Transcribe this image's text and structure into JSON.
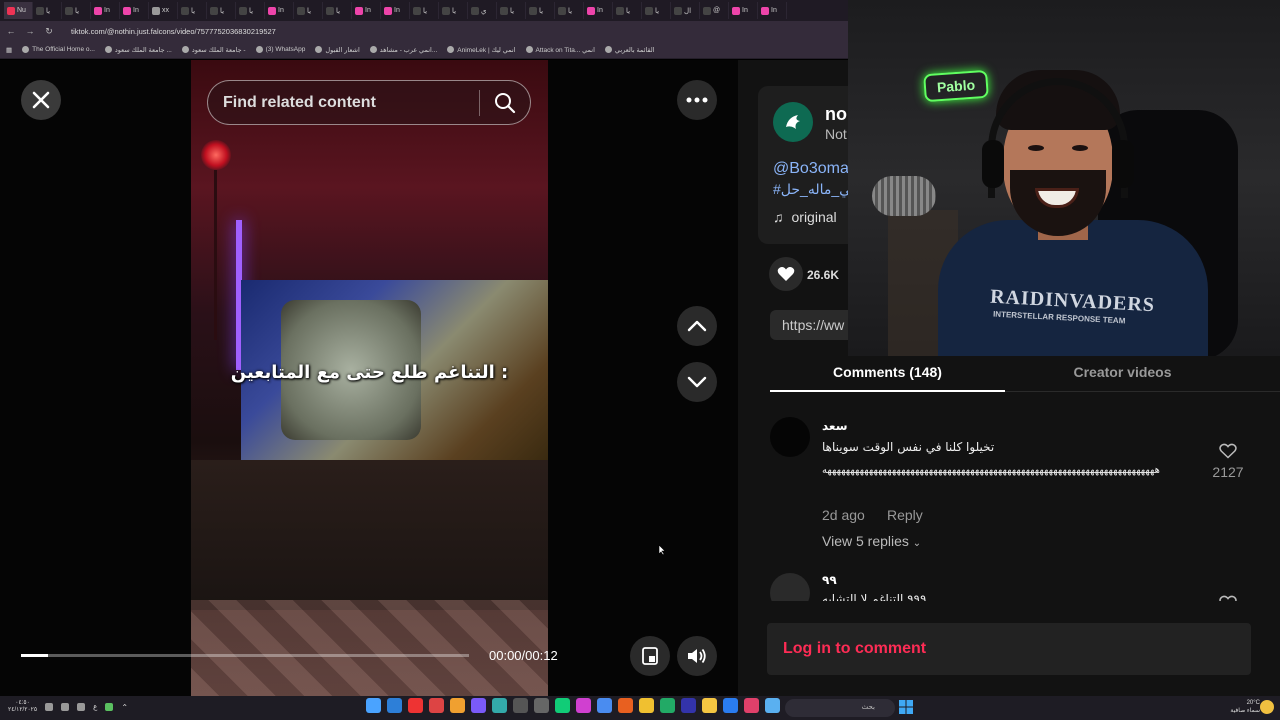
{
  "browser": {
    "tabs": [
      {
        "label": "Nu"
      },
      {
        "label": "يا"
      },
      {
        "label": "يا"
      },
      {
        "label": "In"
      },
      {
        "label": "In"
      },
      {
        "label": "xx"
      },
      {
        "label": "يا"
      },
      {
        "label": "يا"
      },
      {
        "label": "يا"
      },
      {
        "label": "In"
      },
      {
        "label": "يا"
      },
      {
        "label": "يا"
      },
      {
        "label": "In"
      },
      {
        "label": "In"
      },
      {
        "label": "يا"
      },
      {
        "label": "يا"
      },
      {
        "label": "ي"
      },
      {
        "label": "يا"
      },
      {
        "label": "يا"
      },
      {
        "label": "يا"
      },
      {
        "label": "In"
      },
      {
        "label": "يا"
      },
      {
        "label": "يا"
      },
      {
        "label": "ال"
      },
      {
        "label": "@"
      },
      {
        "label": "In"
      },
      {
        "label": "In"
      }
    ],
    "url": "tiktok.com/@nothin.just.falcons/video/7577752036830219527",
    "bookmarks": [
      "The Official Home o...",
      "جامعة الملك سعود ...",
      "جامعة الملك سعود -",
      "(3) WhatsApp",
      "اشعار القبول",
      "انمي عرب - مشاهد...",
      "AnimeLek | انمي ليك",
      "Attack on Tita... انمي",
      "القائمة بالعربي"
    ]
  },
  "video": {
    "search_placeholder": "Find related content",
    "caption": "التناغم طلع حتى مع المتابعين :",
    "time": "00:00/00:12",
    "progress": 0.06
  },
  "author": {
    "name": "no",
    "subtitle": "Not",
    "mention": "@Bo3oma",
    "hashtag": "#اللي_ماله_حل",
    "sound": "original",
    "likes": "26.6K",
    "link": "https://ww"
  },
  "tabs": {
    "comments": "Comments (148)",
    "creator": "Creator videos"
  },
  "comments": [
    {
      "user": "سعد",
      "text": "تخيلوا كلنا في نفس الوقت سويناها",
      "long": "ههههههههههههههههههههههههههههههههههههههههههههههههههههههههههههههههههههههههه",
      "time": "2d ago",
      "reply": "Reply",
      "view_replies": "View 5 replies",
      "likes": "2127"
    },
    {
      "user": "٩٩",
      "text": "٩٩٩ التناغم لا التشابه"
    }
  ],
  "login": "Log in to comment",
  "webcam": {
    "neon": "Pablo",
    "shirt": "RAIDINVADERS",
    "shirt_sub": "INTERSTELLAR RESPONSE TEAM"
  },
  "taskbar": {
    "clock_time": "٠٤:٥٠",
    "clock_date": "٢٤/١٢/٢٠٢٥",
    "search": "بحث",
    "weather_temp": "20°C",
    "weather_desc": "سماء صافية",
    "lang": "ع"
  }
}
